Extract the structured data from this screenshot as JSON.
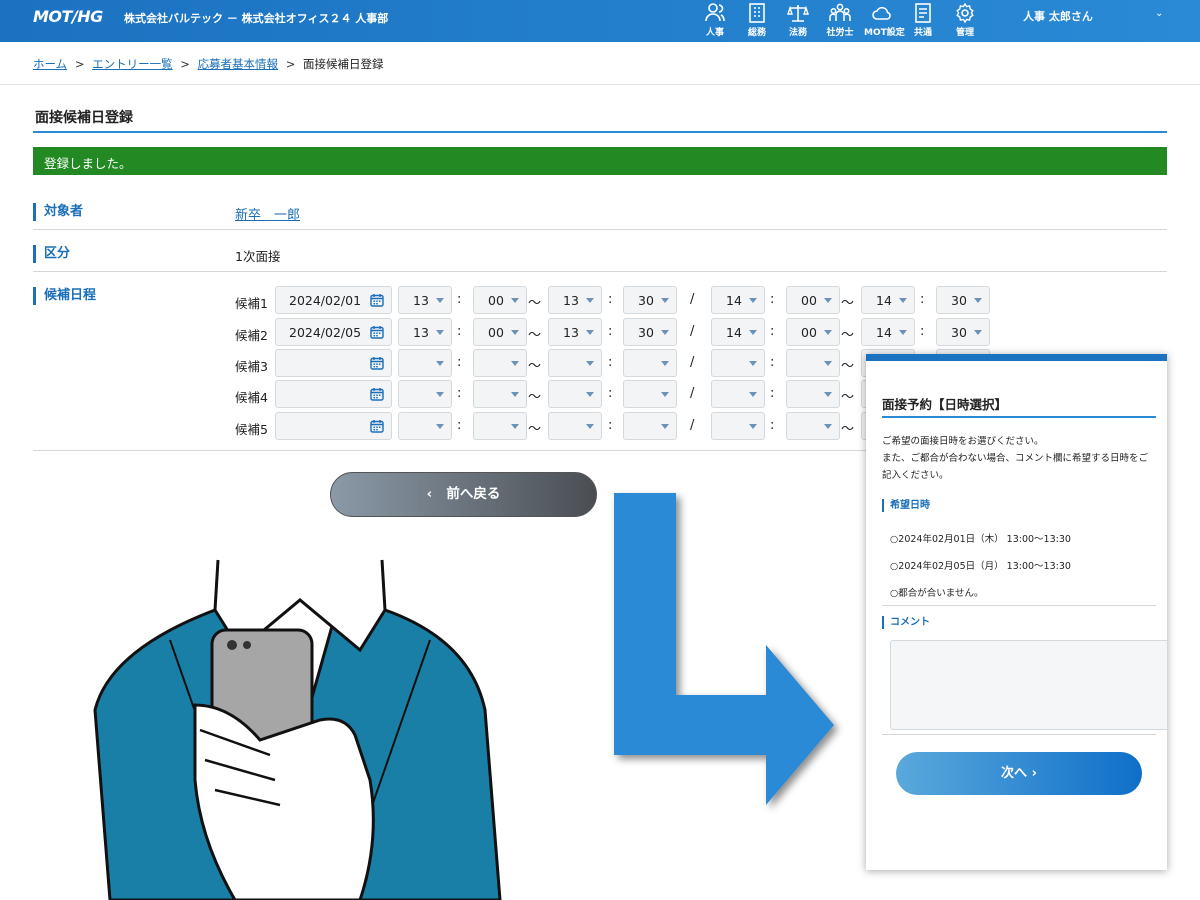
{
  "header": {
    "logo": "MOT/HG",
    "company": "株式会社バルテック － 株式会社オフィス２４ 人事部",
    "nav": [
      {
        "label": "人事",
        "icon": "people-icon"
      },
      {
        "label": "総務",
        "icon": "building-icon"
      },
      {
        "label": "法務",
        "icon": "scale-icon"
      },
      {
        "label": "社労士",
        "icon": "group-icon"
      },
      {
        "label": "MOT設定",
        "icon": "cloud-icon"
      },
      {
        "label": "共通",
        "icon": "document-icon"
      },
      {
        "label": "管理",
        "icon": "gear-icon"
      }
    ],
    "user": "人事 太郎さん",
    "user_chevron": "⌄"
  },
  "breadcrumb": {
    "home": "ホーム",
    "entry_list": "エントリー一覧",
    "applicant": "応募者基本情報",
    "current": "面接候補日登録",
    "sep": ">"
  },
  "page": {
    "title": "面接候補日登録",
    "success": "登録しました。"
  },
  "form": {
    "target_label": "対象者",
    "target_value": "新卒　一郎",
    "category_label": "区分",
    "category_value": "1次面接",
    "schedule_label": "候補日程",
    "colon": ":",
    "tilde": "〜",
    "slash": "/",
    "candidates": [
      {
        "label": "候補1",
        "date": "2024/02/01",
        "t": [
          "13",
          "00",
          "13",
          "30",
          "14",
          "00",
          "14",
          "30"
        ]
      },
      {
        "label": "候補2",
        "date": "2024/02/05",
        "t": [
          "13",
          "00",
          "13",
          "30",
          "14",
          "00",
          "14",
          "30"
        ]
      },
      {
        "label": "候補3",
        "date": "",
        "t": [
          "",
          "",
          "",
          "",
          "",
          "",
          "",
          ""
        ]
      },
      {
        "label": "候補4",
        "date": "",
        "t": [
          "",
          "",
          "",
          "",
          "",
          "",
          "",
          ""
        ]
      },
      {
        "label": "候補5",
        "date": "",
        "t": [
          "",
          "",
          "",
          "",
          "",
          "",
          "",
          ""
        ]
      }
    ],
    "back_button": "前へ戻る",
    "back_chevron": "‹"
  },
  "modal": {
    "title": "面接予約【日時選択】",
    "desc": "ご希望の面接日時をお選びください。\nまた、ご都合が合わない場合、コメント欄に希望する日時をご記入ください。",
    "desired_label": "希望日時",
    "options": [
      "○2024年02月01日（木） 13:00〜13:30",
      "○2024年02月05日（月） 13:00〜13:30",
      "○都合が合いません。"
    ],
    "comment_label": "コメント",
    "comment_value": "",
    "next_button": "次へ ›"
  },
  "colors": {
    "header": "#1b72c0",
    "accent": "#2a8ad6",
    "link": "#1a6fb8",
    "success": "#238a23",
    "arrow": "#2a8ad6",
    "jacket": "#1a7fa6"
  }
}
